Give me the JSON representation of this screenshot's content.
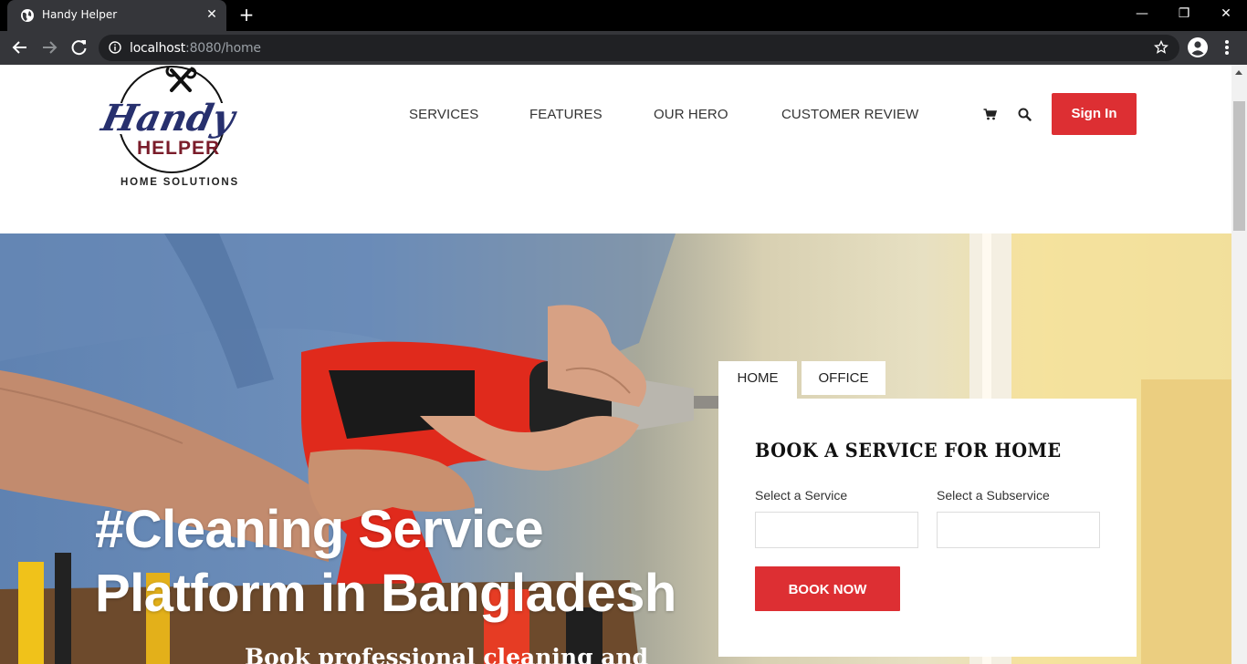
{
  "browser": {
    "tab_title": "Handy Helper",
    "tab_close": "✕",
    "new_tab": "+",
    "url_host": "localhost",
    "url_rest": ":8080/home",
    "window_controls": {
      "minimize": "—",
      "restore": "❐",
      "close": "✕"
    }
  },
  "header": {
    "logo": {
      "line1": "Handy",
      "line2": "HELPER",
      "line3": "HOME SOLUTIONS"
    },
    "nav": [
      "SERVICES",
      "FEATURES",
      "OUR HERO",
      "CUSTOMER REVIEW"
    ],
    "sign_in": "Sign In"
  },
  "hero": {
    "headline_line1": "#Cleaning Service",
    "headline_line2": "Platform in Bangladesh",
    "subline": "Book professional cleaning and"
  },
  "booking": {
    "tabs": [
      "HOME",
      "OFFICE"
    ],
    "active_tab": "HOME",
    "title": "BOOK A SERVICE FOR HOME",
    "service_label": "Select a Service",
    "subservice_label": "Select a Subservice",
    "service_value": "",
    "subservice_value": "",
    "button": "BOOK NOW"
  },
  "colors": {
    "accent": "#dd2f33",
    "logo_navy": "#27306e",
    "logo_maroon": "#7a1c2a"
  },
  "icons": [
    "globe-icon",
    "back-icon",
    "forward-icon",
    "reload-icon",
    "info-icon",
    "star-icon",
    "account-icon",
    "menu-icon",
    "cart-icon",
    "search-icon"
  ]
}
